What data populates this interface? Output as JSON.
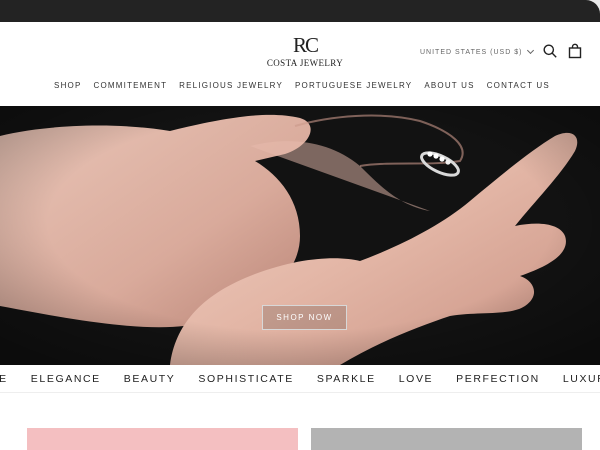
{
  "header": {
    "logo_mark": "RC",
    "logo_name": "Costa Jewelry",
    "currency": "UNITED STATES (USD $)",
    "search_icon": "search-icon",
    "cart_icon": "shopping-bag-icon"
  },
  "nav": {
    "items": [
      {
        "label": "SHOP"
      },
      {
        "label": "COMMITEMENT"
      },
      {
        "label": "RELIGIOUS JEWELRY"
      },
      {
        "label": "PORTUGUESE JEWELRY"
      },
      {
        "label": "ABOUT US"
      },
      {
        "label": "CONTACT US"
      }
    ]
  },
  "hero": {
    "cta_label": "SHOP NOW"
  },
  "marquee": {
    "words": [
      "CE",
      "ELEGANCE",
      "BEAUTY",
      "SOPHISTICATE",
      "SPARKLE",
      "LOVE",
      "PERFECTION",
      "LUXURY"
    ]
  },
  "colors": {
    "topbar": "#232323",
    "accent_pink": "#f4bfc1",
    "accent_gray": "#b3b3b3"
  }
}
